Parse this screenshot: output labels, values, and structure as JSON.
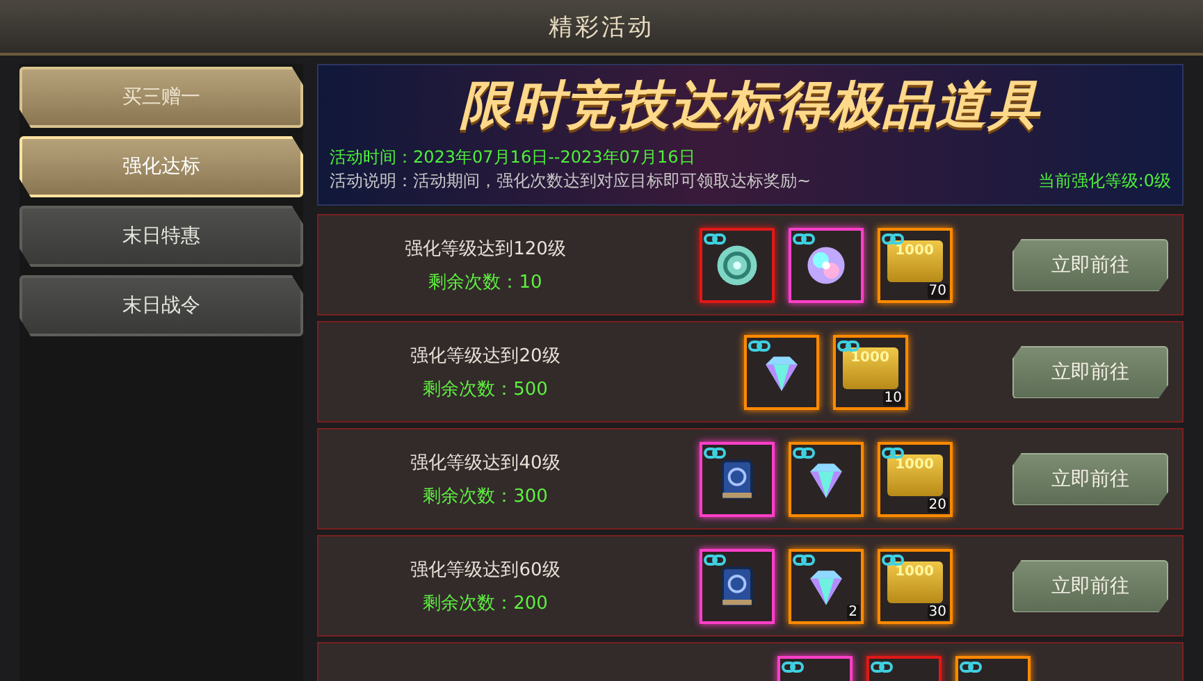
{
  "window": {
    "title": "精彩活动"
  },
  "sidebar": {
    "tabs": [
      {
        "label": "买三赠一",
        "featured": true,
        "selected": false
      },
      {
        "label": "强化达标",
        "featured": true,
        "selected": true
      },
      {
        "label": "末日特惠",
        "featured": false,
        "selected": false
      },
      {
        "label": "末日战令",
        "featured": false,
        "selected": false
      }
    ]
  },
  "banner": {
    "headline": "限时竞技达标得极品道具",
    "time_label": "活动时间：",
    "time_value": "2023年07月16日--2023年07月16日",
    "description": "活动说明：活动期间，强化次数达到对应目标即可领取达标奖励~",
    "current_level": "当前强化等级:0级"
  },
  "rows": [
    {
      "goal": "强化等级达到120级",
      "remaining": "剩余次数：10",
      "button": "立即前往",
      "rewards": [
        {
          "kind": "orb",
          "color": "#e01818"
        },
        {
          "kind": "gem",
          "color": "#ff3fc8"
        },
        {
          "kind": "gold",
          "color": "#ff8a00",
          "label": "1000",
          "count": "70"
        }
      ]
    },
    {
      "goal": "强化等级达到20级",
      "remaining": "剩余次数：500",
      "button": "立即前往",
      "rewards": [
        {
          "kind": "diamond",
          "color": "#ff8a00"
        },
        {
          "kind": "gold",
          "color": "#ff8a00",
          "label": "1000",
          "count": "10"
        }
      ]
    },
    {
      "goal": "强化等级达到40级",
      "remaining": "剩余次数：300",
      "button": "立即前往",
      "rewards": [
        {
          "kind": "book",
          "color": "#ff3fc8"
        },
        {
          "kind": "diamond",
          "color": "#ff8a00"
        },
        {
          "kind": "gold",
          "color": "#ff8a00",
          "label": "1000",
          "count": "20"
        }
      ]
    },
    {
      "goal": "强化等级达到60级",
      "remaining": "剩余次数：200",
      "button": "立即前往",
      "rewards": [
        {
          "kind": "book",
          "color": "#ff3fc8"
        },
        {
          "kind": "diamond",
          "color": "#ff8a00",
          "count": "2"
        },
        {
          "kind": "gold",
          "color": "#ff8a00",
          "label": "1000",
          "count": "30"
        }
      ]
    },
    {
      "rewards": [
        {
          "kind": "frame",
          "color": "#ff3fc8"
        },
        {
          "kind": "frame",
          "color": "#e01818"
        },
        {
          "kind": "frame",
          "color": "#ff8a00"
        }
      ]
    }
  ]
}
